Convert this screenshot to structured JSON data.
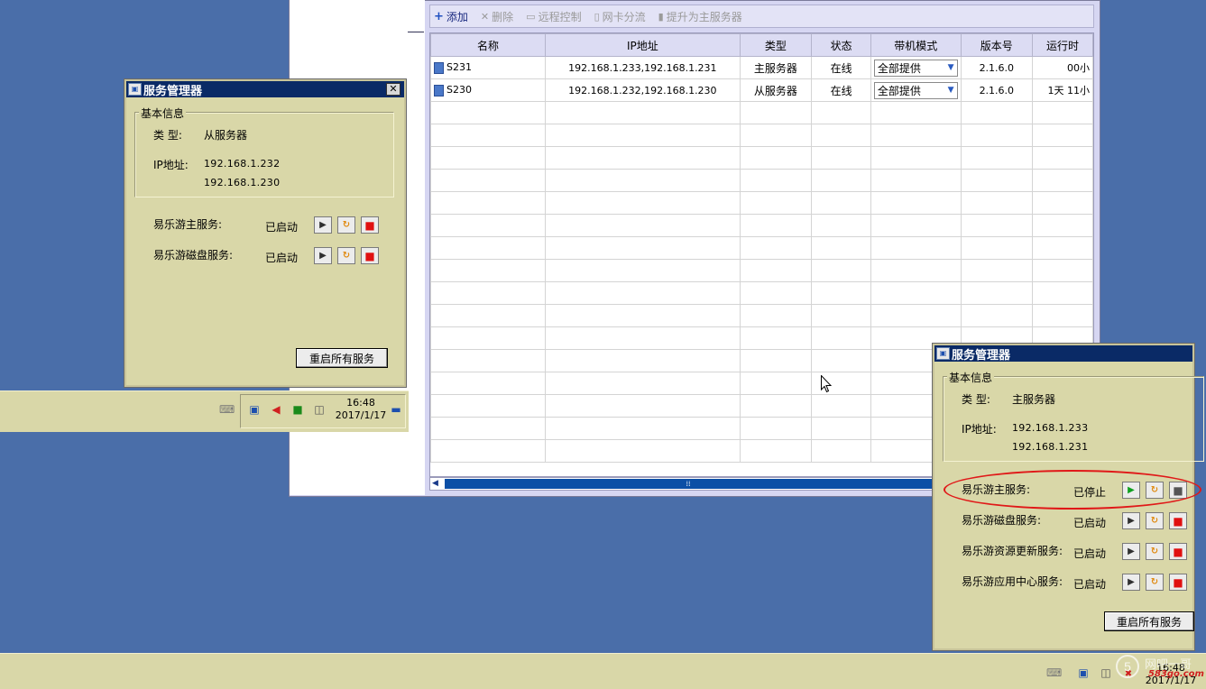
{
  "toolbar": {
    "add": "添加",
    "delete": "删除",
    "remote": "远程控制",
    "nic": "网卡分流",
    "promote": "提升为主服务器"
  },
  "grid": {
    "headers": [
      "名称",
      "IP地址",
      "类型",
      "状态",
      "带机模式",
      "版本号",
      "运行时"
    ],
    "rows": [
      {
        "name": "S231",
        "ip": "192.168.1.233,192.168.1.231",
        "type": "主服务器",
        "status": "在线",
        "mode": "全部提供",
        "version": "2.1.6.0",
        "uptime": "00小"
      },
      {
        "name": "S230",
        "ip": "192.168.1.232,192.168.1.230",
        "type": "从服务器",
        "status": "在线",
        "mode": "全部提供",
        "version": "2.1.6.0",
        "uptime": "1天 11小"
      }
    ],
    "scroll_grip": "⁞⁞"
  },
  "dialog_left": {
    "title": "服务管理器",
    "group": "基本信息",
    "type_label": "类 型:",
    "type_value": "从服务器",
    "ip_label": "IP地址:",
    "ip1": "192.168.1.232",
    "ip2": "192.168.1.230",
    "services": [
      {
        "name": "易乐游主服务:",
        "status": "已启动"
      },
      {
        "name": "易乐游磁盘服务:",
        "status": "已启动"
      }
    ],
    "restart_all": "重启所有服务"
  },
  "dialog_right": {
    "title": "服务管理器",
    "group": "基本信息",
    "type_label": "类 型:",
    "type_value": "主服务器",
    "ip_label": "IP地址:",
    "ip1": "192.168.1.233",
    "ip2": "192.168.1.231",
    "services": [
      {
        "name": "易乐游主服务:",
        "status": "已停止"
      },
      {
        "name": "易乐游磁盘服务:",
        "status": "已启动"
      },
      {
        "name": "易乐游资源更新服务:",
        "status": "已启动"
      },
      {
        "name": "易乐游应用中心服务:",
        "status": "已启动"
      }
    ],
    "restart_all": "重启所有服务"
  },
  "taskbar_left": {
    "time": "16:48",
    "date": "2017/1/17"
  },
  "taskbar_bottom": {
    "time": "16:48",
    "date": "2017/1/17"
  },
  "watermark": {
    "text": "网吧一哥",
    "site": "583go.com"
  },
  "colors": {
    "desktop": "#4a6ea9",
    "dialog_bg": "#d9d7a8",
    "titlebar": "#0a2a66",
    "highlight": "#e01818"
  }
}
